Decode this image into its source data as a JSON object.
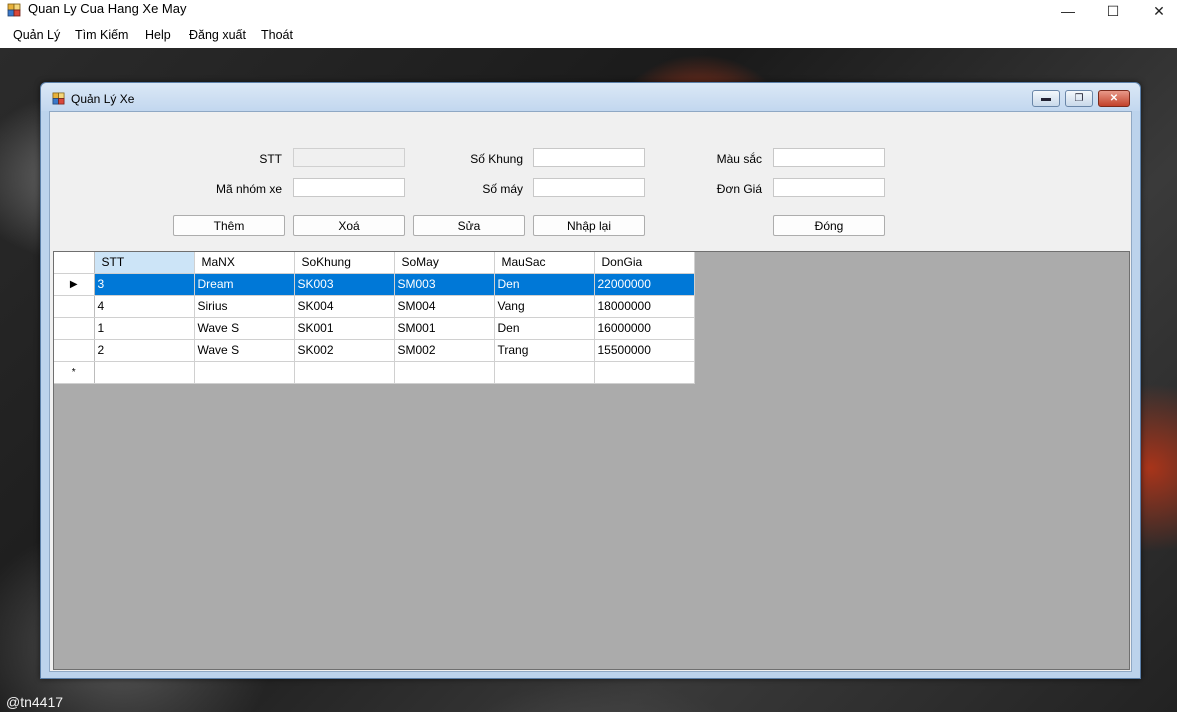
{
  "app": {
    "title": "Quan Ly Cua Hang Xe May"
  },
  "window_controls": {
    "minimize": "—",
    "maximize": "☐",
    "close": "✕"
  },
  "menu": {
    "items": [
      "Quản Lý",
      "Tìm Kiếm",
      "Help",
      "Đăng xuất",
      "Thoát"
    ]
  },
  "child": {
    "title": "Quản Lý Xe",
    "controls": {
      "minimize": "▬",
      "restore": "❐",
      "close": "✕"
    }
  },
  "form": {
    "stt_label": "STT",
    "stt_value": "",
    "manhom_label": "Mã nhóm xe",
    "manhom_value": "",
    "sokhung_label": "Số Khung",
    "sokhung_value": "",
    "somay_label": "Số máy",
    "somay_value": "",
    "mausac_label": "Màu sắc",
    "mausac_value": "",
    "dongia_label": "Đơn Giá",
    "dongia_value": ""
  },
  "buttons": {
    "them": "Thêm",
    "xoa": "Xoá",
    "sua": "Sửa",
    "nhaplai": "Nhập lại",
    "dong": "Đóng"
  },
  "grid": {
    "columns": [
      "STT",
      "MaNX",
      "SoKhung",
      "SoMay",
      "MauSac",
      "DonGia"
    ],
    "sorted_column": "STT",
    "current_row_marker": "▶",
    "new_row_marker": "*",
    "rows": [
      [
        "3",
        "Dream",
        "SK003",
        "SM003",
        "Den",
        "22000000"
      ],
      [
        "4",
        "Sirius",
        "SK004",
        "SM004",
        "Vang",
        "18000000"
      ],
      [
        "1",
        "Wave S",
        "SK001",
        "SM001",
        "Den",
        "16000000"
      ],
      [
        "2",
        "Wave S",
        "SK002",
        "SM002",
        "Trang",
        "15500000"
      ]
    ],
    "selected_row": 0
  },
  "footer": {
    "user_tag": "@tn4417"
  },
  "colors": {
    "selection": "#0078d7",
    "grid_background": "#ababab",
    "sorted_header": "#cce4f7"
  }
}
